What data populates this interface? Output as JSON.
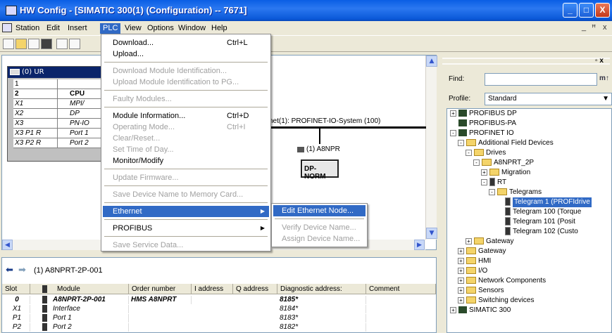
{
  "window": {
    "title": "HW Config - [SIMATIC 300(1) (Configuration) -- 7671]",
    "minimize": "_",
    "maximize": "□",
    "close": "X",
    "mdi_min": "_",
    "mdi_restore": "ꟸ",
    "mdi_close": "x"
  },
  "menubar": [
    "Station",
    "Edit",
    "Insert",
    "PLC",
    "View",
    "Options",
    "Window",
    "Help"
  ],
  "station": {
    "rack_title": "(0) UR",
    "slots": [
      {
        "slot": "1",
        "module": ""
      },
      {
        "slot": "2",
        "module": "CPU"
      },
      {
        "slot": "X1",
        "module": "MPI/"
      },
      {
        "slot": "X2",
        "module": "DP"
      },
      {
        "slot": "X3",
        "module": "PN-IO"
      },
      {
        "slot": "X3 P1 R",
        "module": "Port 1"
      },
      {
        "slot": "X3 P2 R",
        "module": "Port 2"
      }
    ],
    "network_label": "net(1): PROFINET-IO-System (100)",
    "device_label": "(1) A8NPR",
    "device_box": "DP-NORM"
  },
  "plc_menu": [
    {
      "label": "Download...",
      "shortcut": "Ctrl+L",
      "enabled": true
    },
    {
      "label": "Upload...",
      "shortcut": "",
      "enabled": true
    },
    {
      "sep": true
    },
    {
      "label": "Download Module Identification...",
      "shortcut": "",
      "enabled": false
    },
    {
      "label": "Upload Module Identification to PG...",
      "shortcut": "",
      "enabled": false
    },
    {
      "sep": true
    },
    {
      "label": "Faulty Modules...",
      "shortcut": "",
      "enabled": false
    },
    {
      "sep": true
    },
    {
      "label": "Module Information...",
      "shortcut": "Ctrl+D",
      "enabled": true
    },
    {
      "label": "Operating Mode...",
      "shortcut": "Ctrl+I",
      "enabled": false
    },
    {
      "label": "Clear/Reset...",
      "shortcut": "",
      "enabled": false
    },
    {
      "label": "Set Time of Day...",
      "shortcut": "",
      "enabled": false
    },
    {
      "label": "Monitor/Modify",
      "shortcut": "",
      "enabled": true
    },
    {
      "sep": true
    },
    {
      "label": "Update Firmware...",
      "shortcut": "",
      "enabled": false
    },
    {
      "sep": true
    },
    {
      "label": "Save Device Name to Memory Card...",
      "shortcut": "",
      "enabled": false
    },
    {
      "sep": true
    },
    {
      "label": "Ethernet",
      "shortcut": "",
      "enabled": true,
      "submenu": true,
      "selected": true
    },
    {
      "sep": true
    },
    {
      "label": "PROFIBUS",
      "shortcut": "",
      "enabled": true,
      "submenu": true
    },
    {
      "sep": true
    },
    {
      "label": "Save Service Data...",
      "shortcut": "",
      "enabled": false
    }
  ],
  "ethernet_submenu": [
    {
      "label": "Edit Ethernet Node...",
      "enabled": true,
      "selected": true
    },
    {
      "label": "Verify Device Name...",
      "enabled": false
    },
    {
      "label": "Assign Device Name...",
      "enabled": false
    }
  ],
  "detail": {
    "title": "(1)  A8NPRT-2P-001",
    "columns": [
      "Slot",
      "Module",
      "Order number",
      "I address",
      "Q address",
      "Diagnostic address:",
      "Comment"
    ],
    "rows": [
      {
        "slot": "0",
        "module": "A8NPRT-2P-001",
        "order": "HMS A8NPRT",
        "iaddr": "",
        "qaddr": "",
        "diag": "8185*",
        "comment": "",
        "bold": true
      },
      {
        "slot": "X1",
        "module": "Interface",
        "order": "",
        "iaddr": "",
        "qaddr": "",
        "diag": "8184*",
        "comment": ""
      },
      {
        "slot": "P1",
        "module": "Port 1",
        "order": "",
        "iaddr": "",
        "qaddr": "",
        "diag": "8183*",
        "comment": ""
      },
      {
        "slot": "P2",
        "module": "Port 2",
        "order": "",
        "iaddr": "",
        "qaddr": "",
        "diag": "8182*",
        "comment": ""
      }
    ]
  },
  "catalog": {
    "find_label": "Find:",
    "profile_label": "Profile:",
    "profile_value": "Standard",
    "tree": [
      {
        "label": "PROFIBUS DP",
        "indent": 0,
        "pfx": "+",
        "icon": "net"
      },
      {
        "label": "PROFIBUS-PA",
        "indent": 0,
        "pfx": "",
        "icon": "net"
      },
      {
        "label": "PROFINET IO",
        "indent": 0,
        "pfx": "-",
        "icon": "net"
      },
      {
        "label": "Additional Field Devices",
        "indent": 1,
        "pfx": "-",
        "icon": "folder"
      },
      {
        "label": "Drives",
        "indent": 2,
        "pfx": "-",
        "icon": "folder"
      },
      {
        "label": "A8NPRT_2P",
        "indent": 3,
        "pfx": "-",
        "icon": "folder"
      },
      {
        "label": "Migration",
        "indent": 4,
        "pfx": "+",
        "icon": "folder"
      },
      {
        "label": "RT",
        "indent": 4,
        "pfx": "-",
        "icon": "dev"
      },
      {
        "label": "Telegrams",
        "indent": 5,
        "pfx": "-",
        "icon": "folder"
      },
      {
        "label": "Telegram 1 (PROFIdrive",
        "indent": 6,
        "pfx": "",
        "icon": "dev",
        "selected": true
      },
      {
        "label": "Telegram 100 (Torque",
        "indent": 6,
        "pfx": "",
        "icon": "dev"
      },
      {
        "label": "Telegram 101 (Posit",
        "indent": 6,
        "pfx": "",
        "icon": "dev"
      },
      {
        "label": "Telegram 102 (Custo",
        "indent": 6,
        "pfx": "",
        "icon": "dev"
      },
      {
        "label": "Gateway",
        "indent": 2,
        "pfx": "+",
        "icon": "folder"
      },
      {
        "label": "Gateway",
        "indent": 1,
        "pfx": "+",
        "icon": "folder"
      },
      {
        "label": "HMI",
        "indent": 1,
        "pfx": "+",
        "icon": "folder"
      },
      {
        "label": "I/O",
        "indent": 1,
        "pfx": "+",
        "icon": "folder"
      },
      {
        "label": "Network Components",
        "indent": 1,
        "pfx": "+",
        "icon": "folder"
      },
      {
        "label": "Sensors",
        "indent": 1,
        "pfx": "+",
        "icon": "folder"
      },
      {
        "label": "Switching devices",
        "indent": 1,
        "pfx": "+",
        "icon": "folder"
      },
      {
        "label": "SIMATIC 300",
        "indent": 0,
        "pfx": "+",
        "icon": "net"
      }
    ]
  },
  "colors": {
    "selection": "#316ac5",
    "titlebar": "#0a5ee4"
  }
}
